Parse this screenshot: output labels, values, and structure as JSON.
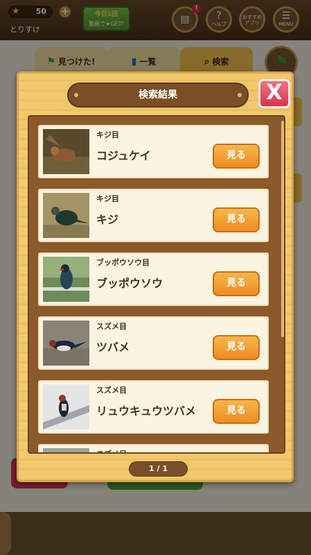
{
  "header": {
    "star_count": "50",
    "plus": "+",
    "user_name": "とりすけ",
    "promo_top": "今日1回",
    "promo_bottom": "動画で★GET!",
    "notification_badge": "!",
    "help_label": "ヘルプ",
    "recommend_label": "おすすめ\nアプリ",
    "menu_label": "MENU"
  },
  "tabs": {
    "found": "見つけた!",
    "list": "一覧",
    "search": "検索"
  },
  "modal": {
    "title": "検索結果",
    "close_label": "X",
    "pager": "1 / 1",
    "results": [
      {
        "order": "キジ目",
        "name": "コジュケイ",
        "button": "見る"
      },
      {
        "order": "キジ目",
        "name": "キジ",
        "button": "見る"
      },
      {
        "order": "ブッポウソウ目",
        "name": "ブッポウソウ",
        "button": "見る"
      },
      {
        "order": "スズメ目",
        "name": "ツバメ",
        "button": "見る"
      },
      {
        "order": "スズメ目",
        "name": "リュウキュウツバメ",
        "button": "見る"
      },
      {
        "order": "スズメ目",
        "name": "",
        "button": ""
      }
    ]
  },
  "colors": {
    "accent_orange": "#ee8c1f",
    "wood_brown": "#7a4f27",
    "close_red": "#d8334d",
    "panel_yellow": "#f1c76b"
  }
}
